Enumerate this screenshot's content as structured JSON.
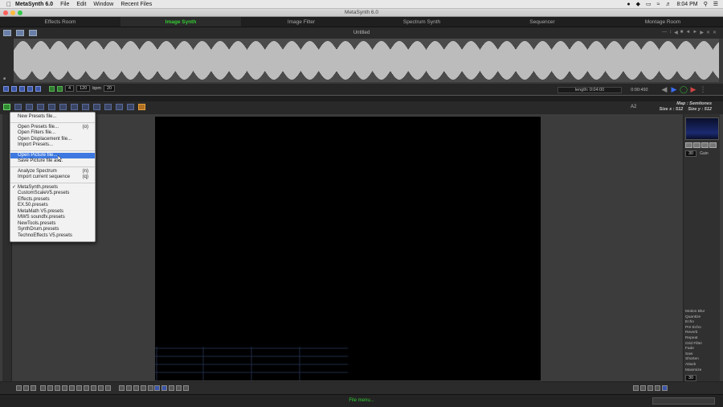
{
  "menubar": {
    "app_name": "MetaSynth 6.0",
    "menus": [
      "File",
      "Edit",
      "Window",
      "Recent Files"
    ],
    "clock": "8:04 PM",
    "status_icons": [
      "controls-icon",
      "dropbox-icon",
      "battery-icon",
      "wifi-icon",
      "volume-icon",
      "search-icon",
      "notifications-icon"
    ]
  },
  "window": {
    "title": "MetaSynth 6.0",
    "document_title": "Untitled"
  },
  "rooms": {
    "tabs": [
      "Effects Room",
      "Image Synth",
      "Image Filter",
      "Spectrum Synth",
      "Sequencer",
      "Montage Room"
    ],
    "active": "Image Synth"
  },
  "transport": {
    "bars_value": "4",
    "bpm_value": "120",
    "bpm_label": "bpm",
    "step_value": "20",
    "length_text": "length: 0:04:00",
    "time_text": "0:00:492"
  },
  "map_info": {
    "line1": "Map : Semitones",
    "line2": "Size x : 512    Size y : 512",
    "a2_label": "A2"
  },
  "right_panel": {
    "gain_value": "30",
    "gain_label": "Gain",
    "effects": [
      "Motion Blur",
      "Quantize",
      "Echo",
      "Pre Echo",
      "Reverb",
      "Repeat",
      "Grid Filter",
      "Fade",
      "Saw",
      "Shorten",
      "Attack",
      "Maximize"
    ],
    "bottom_value": "30"
  },
  "status": {
    "message": "File menu..."
  },
  "file_menu": {
    "group1": [
      {
        "label": "New Presets file..."
      }
    ],
    "group2": [
      {
        "label": "Open Presets file...",
        "shortcut": "(o)"
      },
      {
        "label": "Open Filters file..."
      },
      {
        "label": "Open Displacement file..."
      },
      {
        "label": "Import Presets..."
      }
    ],
    "group3": [
      {
        "label": "Open Picture file...",
        "highlighted": true
      },
      {
        "label": "Save Picture file as..."
      }
    ],
    "group4": [
      {
        "label": "Analyze Spectrum",
        "shortcut": "(n)"
      },
      {
        "label": "Import current sequence",
        "shortcut": "(q)"
      }
    ],
    "group5": [
      {
        "label": "MetaSynth.presets",
        "checked": true
      },
      {
        "label": "CustomScaleV5.presets"
      },
      {
        "label": "Effects.presets"
      },
      {
        "label": "EX.50.presets"
      },
      {
        "label": "MetaMath V5.presets"
      },
      {
        "label": "MWS soundfx.presets"
      },
      {
        "label": "NewTools.presets"
      },
      {
        "label": "SynthDrum.presets"
      },
      {
        "label": "TechnoEffects V5.presets"
      }
    ]
  },
  "colors": {
    "accent_green": "#33cc33",
    "menu_highlight": "#3d78e0",
    "play_blue": "#3a6cf0"
  }
}
